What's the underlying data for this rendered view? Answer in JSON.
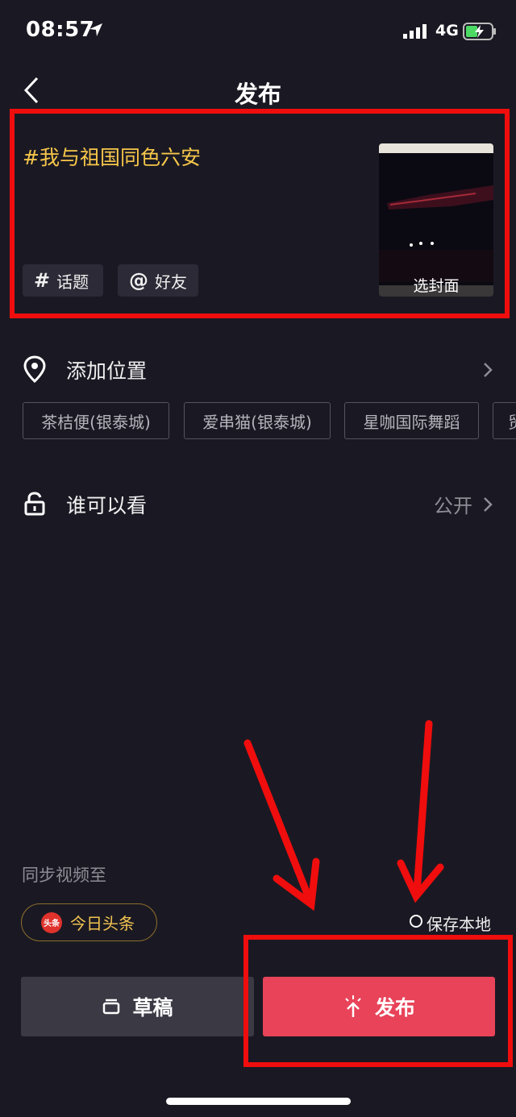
{
  "status_bar": {
    "time": "08:57",
    "network": "4G"
  },
  "header": {
    "title": "发布"
  },
  "post": {
    "caption": "#我与祖国同色六安",
    "topic_label": "话题",
    "friend_label": "好友",
    "cover_label": "选封面"
  },
  "location": {
    "label": "添加位置",
    "suggestions": [
      "茶桔便(银泰城)",
      "爱串猫(银泰城)",
      "星咖国际舞蹈",
      "贸"
    ]
  },
  "visibility": {
    "label": "谁可以看",
    "value": "公开"
  },
  "sync": {
    "label": "同步视频至",
    "toutiao_label": "今日头条",
    "toutiao_logo_text": "头条",
    "save_local_label": "保存本地"
  },
  "actions": {
    "draft_label": "草稿",
    "publish_label": "发布"
  },
  "colors": {
    "background": "#1a1923",
    "caption": "#f7c64a",
    "publish": "#e84359",
    "annotation": "#f00d0d"
  }
}
